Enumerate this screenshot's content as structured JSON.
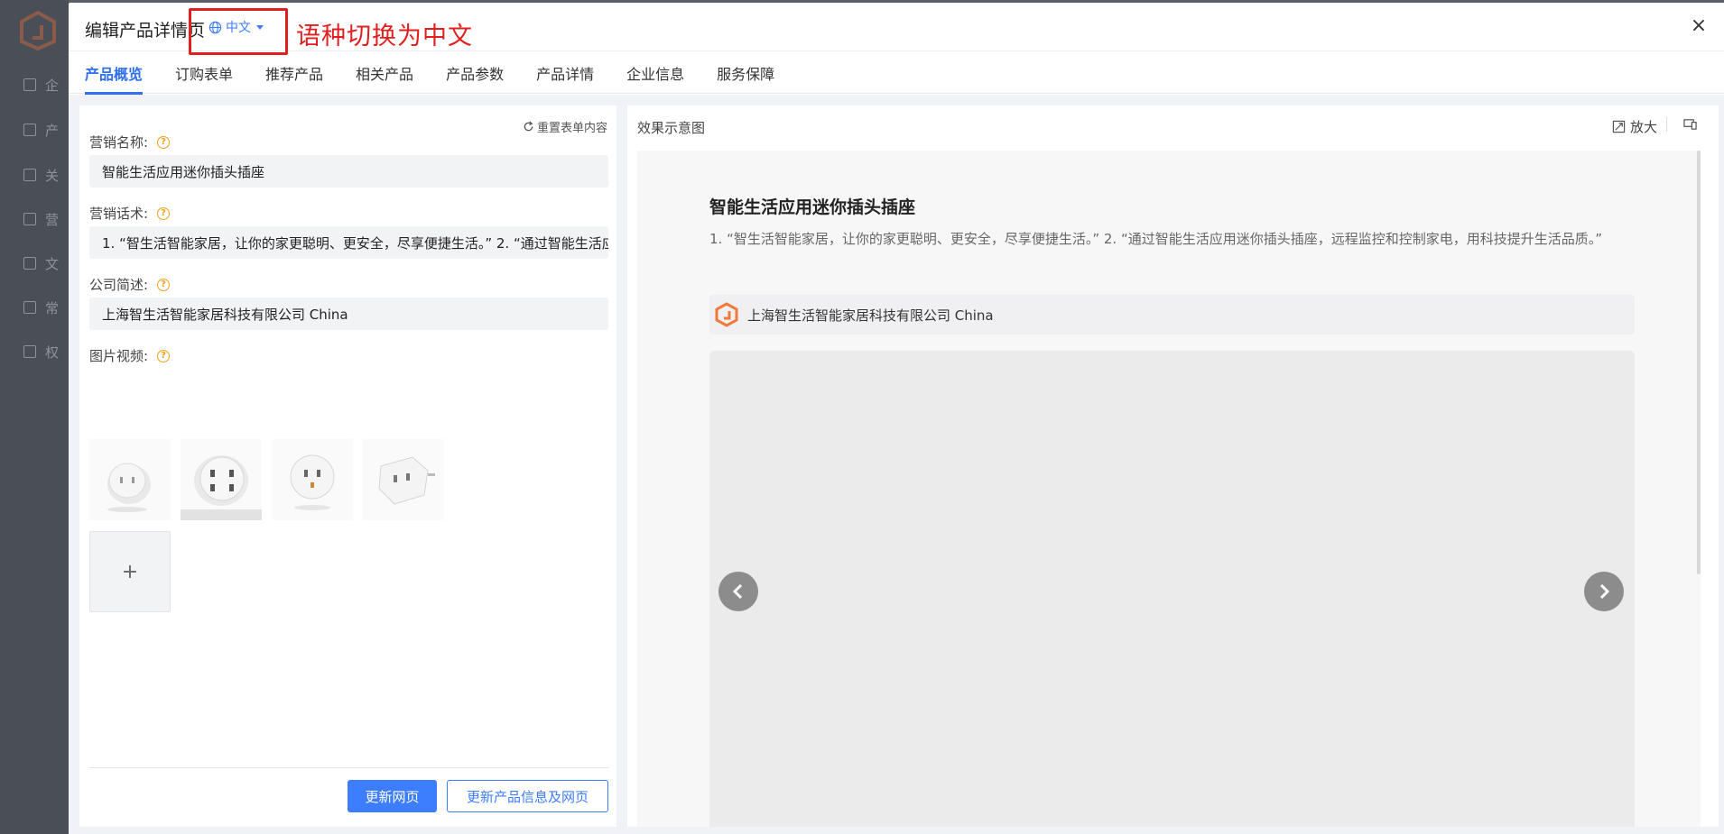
{
  "modal": {
    "title": "编辑产品详情页",
    "language": "中文",
    "annotation": "语种切换为中文",
    "close_icon": "close-icon"
  },
  "background_menu": [
    "企",
    "产",
    "关",
    "营",
    "文",
    "常",
    "权"
  ],
  "tabs": [
    {
      "label": "产品概览",
      "active": true
    },
    {
      "label": "订购表单",
      "active": false
    },
    {
      "label": "推荐产品",
      "active": false
    },
    {
      "label": "相关产品",
      "active": false
    },
    {
      "label": "产品参数",
      "active": false
    },
    {
      "label": "产品详情",
      "active": false
    },
    {
      "label": "企业信息",
      "active": false
    },
    {
      "label": "服务保障",
      "active": false
    }
  ],
  "form": {
    "reset_label": "重置表单内容",
    "marketing_name_label": "营销名称:",
    "marketing_name_value": "智能生活应用迷你插头插座",
    "marketing_copy_label": "营销话术:",
    "marketing_copy_value": "1. “智生活智能家居，让你的家更聪明、更安全，尽享便捷生活。” 2. “通过智能生活应用迷你插头插座，远程监控和控制家电，用科技提升生活品质。”",
    "company_label": "公司简述:",
    "company_value": "上海智生活智能家居科技有限公司 China",
    "media_label": "图片视频:",
    "upload_symbol": "+",
    "update_page_button": "更新网页",
    "update_all_button": "更新产品信息及网页"
  },
  "preview": {
    "title": "效果示意图",
    "zoom_label": "放大",
    "product_title": "智能生活应用迷你插头插座",
    "product_desc": "1. “智生活智能家居，让你的家更聪明、更安全，尽享便捷生活。” 2. “通过智能生活应用迷你插头插座，远程监控和控制家电，用科技提升生活品质。”",
    "company_name": "上海智生活智能家居科技有限公司 China"
  },
  "colors": {
    "accent": "#3d7dff",
    "annotation_red": "#e02020",
    "brand_orange": "#f07a3a"
  }
}
